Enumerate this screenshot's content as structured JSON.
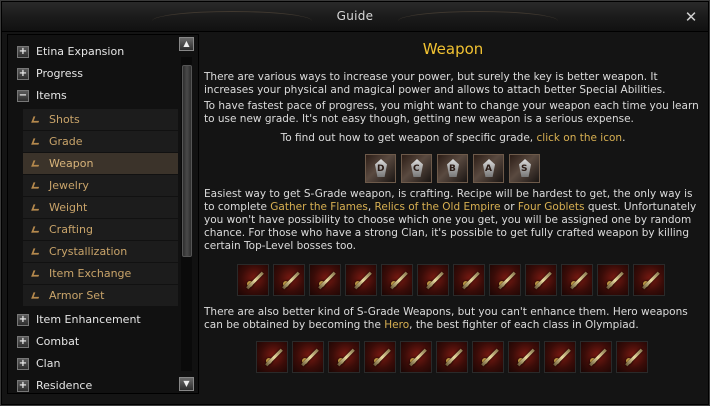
{
  "window": {
    "title": "Guide",
    "close_icon": "close-icon"
  },
  "tree": {
    "top_items": [
      {
        "label": "Etina Expansion",
        "toggle": "+"
      },
      {
        "label": "Progress",
        "toggle": "+"
      },
      {
        "label": "Items",
        "toggle": "−"
      }
    ],
    "sub_items": [
      {
        "label": "Shots",
        "selected": false
      },
      {
        "label": "Grade",
        "selected": false
      },
      {
        "label": "Weapon",
        "selected": true
      },
      {
        "label": "Jewelry",
        "selected": false
      },
      {
        "label": "Weight",
        "selected": false
      },
      {
        "label": "Crafting",
        "selected": false
      },
      {
        "label": "Crystallization",
        "selected": false
      },
      {
        "label": "Item Exchange",
        "selected": false
      },
      {
        "label": "Armor Set",
        "selected": false
      }
    ],
    "bottom_items": [
      {
        "label": "Item Enhancement",
        "toggle": "+"
      },
      {
        "label": "Combat",
        "toggle": "+"
      },
      {
        "label": "Clan",
        "toggle": "+"
      },
      {
        "label": "Residence",
        "toggle": "+"
      }
    ],
    "scroll_up_icon": "arrow-up-icon",
    "scroll_down_icon": "arrow-down-icon"
  },
  "content": {
    "heading": "Weapon",
    "p1": "There are various ways to increase your power, but surely the key is better weapon. It increases your physical and magical power and allows to attach better Special Abilities.",
    "p2": "To have fastest pace of progress, you might want to change your weapon each time you learn to use new grade. It's not easy though, getting new weapon is a serious expense.",
    "p3_prefix": "To find out how to get weapon of specific grade,",
    "p3_link": "click on the icon",
    "p3_suffix": ".",
    "grade_icons": [
      "D",
      "C",
      "B",
      "A",
      "S"
    ],
    "p4_a": "Easiest way to get S-Grade weapon, is crafting. Recipe will be hardest to get, the only way is to complete",
    "p4_link1": "Gather the Flames",
    "p4_sep1": ",",
    "p4_link2": "Relics of the Old Empire",
    "p4_sep2": "or",
    "p4_link3": "Four Goblets",
    "p4_b": "quest. Unfortunately you won't have possibility to choose which one you get, you will be assigned one by random chance. For those who have a strong Clan, it's possible to get fully crafted weapon by killing certain Top-Level bosses too.",
    "weapons_row1_count": 12,
    "p5_a": "There are also better kind of S-Grade Weapons, but you can't enhance them. Hero weapons can be obtained by becoming the",
    "p5_link": "Hero",
    "p5_b": ", the best fighter of each class in Olympiad.",
    "weapons_row2_count": 11
  },
  "colors": {
    "heading": "#f1c232",
    "link": "#d8b052",
    "sub_item_text": "#c9a46a",
    "selected_bg": "#3b332a",
    "text": "#dcdcdc"
  }
}
